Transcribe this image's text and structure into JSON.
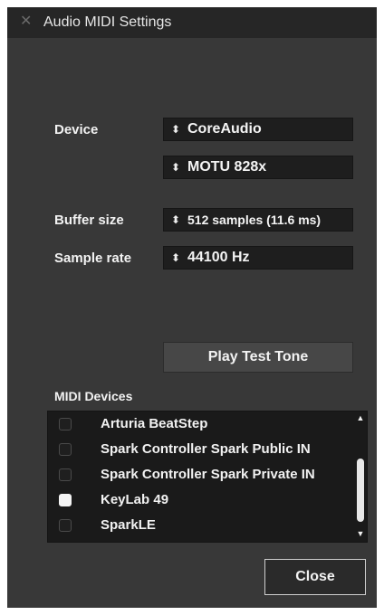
{
  "window": {
    "title": "Audio MIDI Settings",
    "close_glyph": "✕"
  },
  "audio": {
    "device_label": "Device",
    "device_type": "CoreAudio",
    "device_name": "MOTU 828x",
    "buffer_label": "Buffer size",
    "buffer_value": "512 samples (11.6 ms)",
    "rate_label": "Sample rate",
    "rate_value": "44100 Hz",
    "select_arrows": "⬍"
  },
  "play_test_tone_label": "Play Test Tone",
  "midi": {
    "label": "MIDI Devices",
    "devices": [
      {
        "name": "Arturia BeatStep",
        "checked": false
      },
      {
        "name": "Spark Controller Spark Public IN",
        "checked": false
      },
      {
        "name": "Spark Controller Spark Private IN",
        "checked": false
      },
      {
        "name": "KeyLab 49",
        "checked": true
      },
      {
        "name": "SparkLE",
        "checked": false
      }
    ],
    "scroll_up": "▲",
    "scroll_down": "▼"
  },
  "close_label": "Close"
}
